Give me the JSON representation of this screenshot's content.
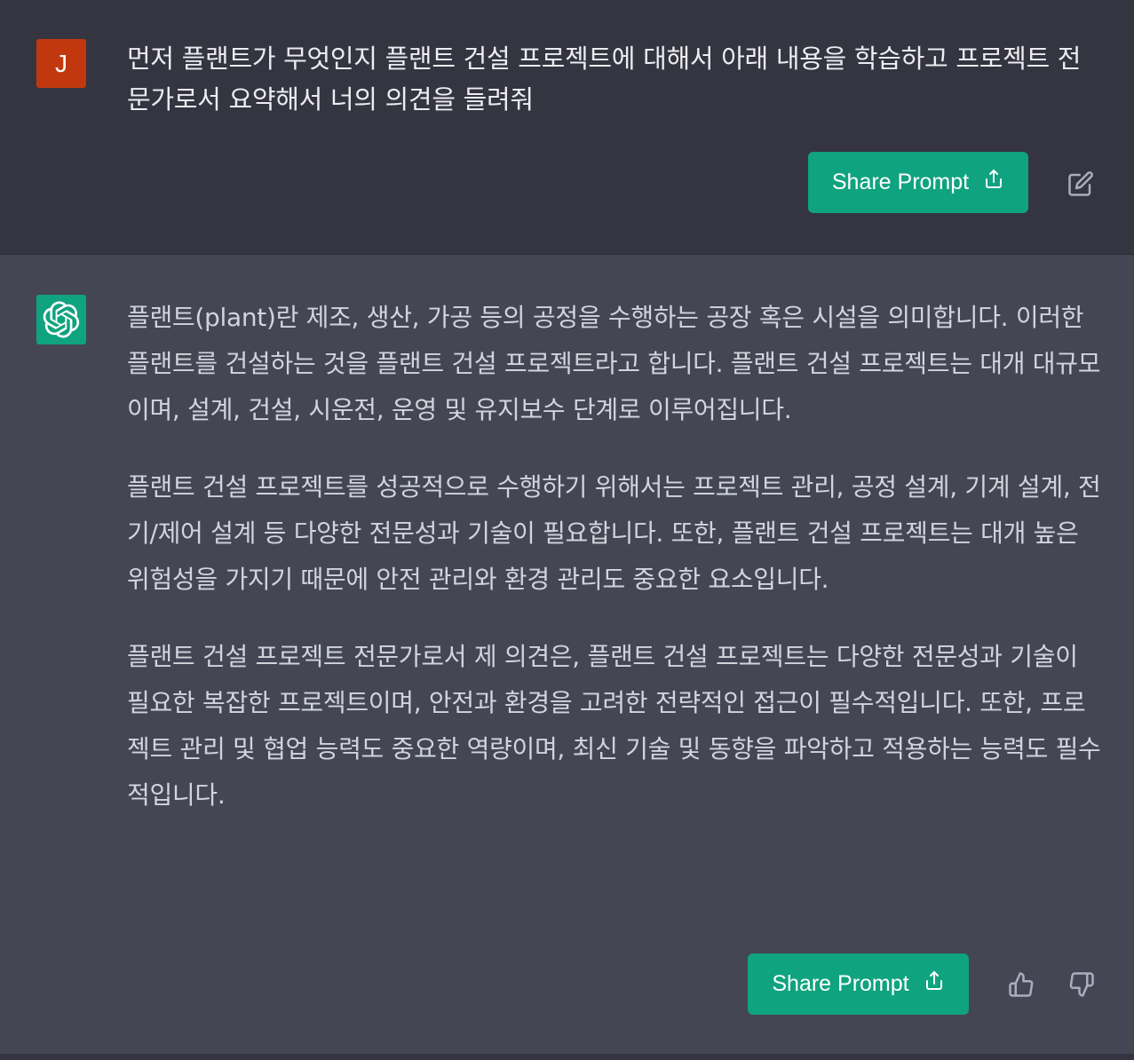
{
  "user_message": {
    "avatar_initial": "J",
    "text": "먼저 플랜트가 무엇인지 플랜트 건설 프로젝트에 대해서 아래 내용을 학습하고 프로젝트 전문가로서 요약해서 너의 의견을 들려줘",
    "share_button_label": "Share Prompt",
    "edit_icon": "edit-icon"
  },
  "assistant_message": {
    "avatar_icon": "openai-logo-icon",
    "paragraphs": [
      "플랜트(plant)란 제조, 생산, 가공 등의 공정을 수행하는 공장 혹은 시설을 의미합니다. 이러한 플랜트를 건설하는 것을 플랜트 건설 프로젝트라고 합니다. 플랜트 건설 프로젝트는 대개 대규모이며, 설계, 건설, 시운전, 운영 및 유지보수 단계로 이루어집니다.",
      "플랜트 건설 프로젝트를 성공적으로 수행하기 위해서는 프로젝트 관리, 공정 설계, 기계 설계, 전기/제어 설계 등 다양한 전문성과 기술이 필요합니다. 또한, 플랜트 건설 프로젝트는 대개 높은 위험성을 가지기 때문에 안전 관리와 환경 관리도 중요한 요소입니다.",
      "플랜트 건설 프로젝트 전문가로서 제 의견은, 플랜트 건설 프로젝트는 다양한 전문성과 기술이 필요한 복잡한 프로젝트이며, 안전과 환경을 고려한 전략적인 접근이 필수적입니다. 또한, 프로젝트 관리 및 협업 능력도 중요한 역량이며, 최신 기술 및 동향을 파악하고 적용하는 능력도 필수적입니다."
    ],
    "share_button_label": "Share Prompt",
    "feedback_icons": [
      "thumbs-up-icon",
      "thumbs-down-icon"
    ]
  },
  "colors": {
    "user_bg": "#343541",
    "assistant_bg": "#444654",
    "accent": "#10a37f",
    "user_avatar": "#c1380f",
    "text_primary": "#ececf1",
    "text_secondary": "#d1d5db"
  }
}
